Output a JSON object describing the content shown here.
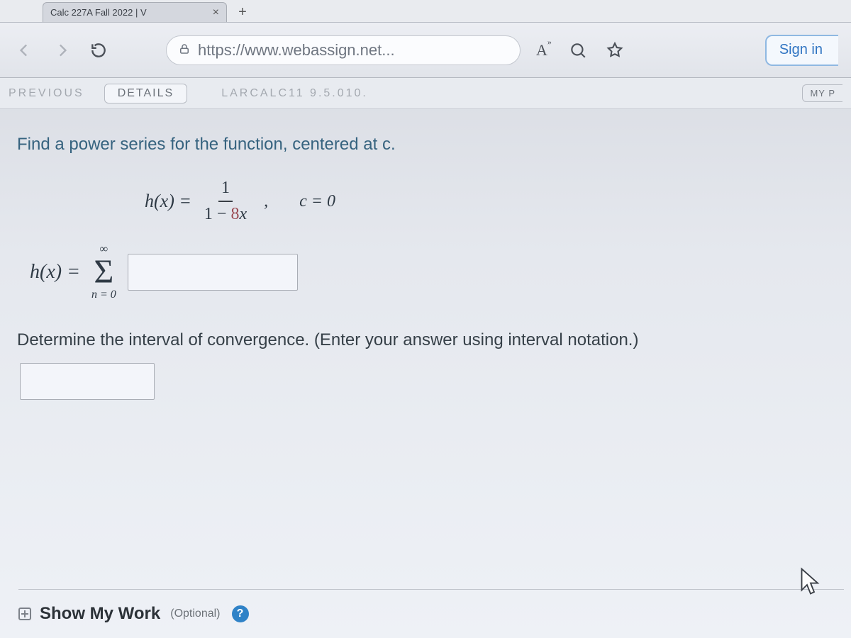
{
  "tab": {
    "title": "Calc 227A Fall 2022 | V",
    "close_glyph": "×",
    "newtab_glyph": "+"
  },
  "toolbar": {
    "url": "https://www.webassign.net...",
    "aa_label": "A",
    "signin_label": "Sign in"
  },
  "subnav": {
    "crumb": "PREVIOUS",
    "details": "DETAILS",
    "reference": "LARCALC11 9.5.010.",
    "badge": "MY P"
  },
  "problem": {
    "prompt1": "Find a power series for the function, centered at c.",
    "func_lhs": "h(x) =",
    "frac_num": "1",
    "frac_den_pre": "1 − ",
    "frac_den_coeff": "8",
    "frac_den_var": "x",
    "trailing_comma": ",",
    "center": "c = 0",
    "sum_lhs": "h(x) =",
    "sigma_top": "∞",
    "sigma_glyph": "Σ",
    "sigma_bottom": "n = 0",
    "prompt2": "Determine the interval of convergence. (Enter your answer using interval notation.)"
  },
  "smw": {
    "toggle_glyph": "⊕",
    "title": "Show My Work",
    "subtitle": "(Optional)",
    "help_glyph": "?"
  }
}
